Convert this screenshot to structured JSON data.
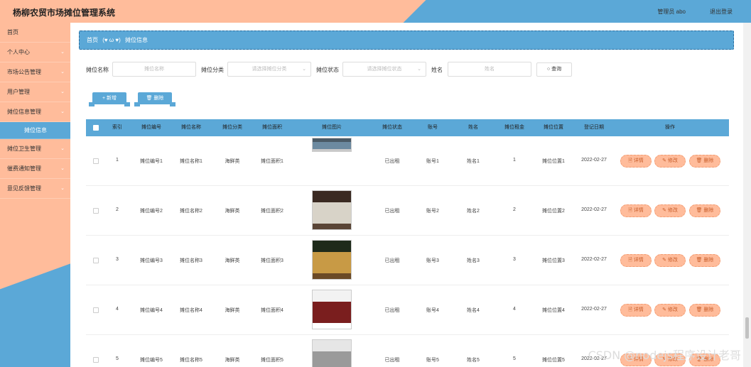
{
  "header": {
    "title": "杨柳农贸市场摊位管理系统",
    "user": "管理员 abo",
    "logout": "退出登录"
  },
  "sidebar": {
    "items": [
      {
        "label": "首页",
        "chev": ""
      },
      {
        "label": "个人中心",
        "chev": "⌄"
      },
      {
        "label": "市场公告管理",
        "chev": "⌄"
      },
      {
        "label": "用户管理",
        "chev": "⌄"
      },
      {
        "label": "摊位信息管理",
        "chev": "⌄"
      },
      {
        "label": "摊位信息",
        "chev": ""
      },
      {
        "label": "摊位卫生管理",
        "chev": "⌄"
      },
      {
        "label": "催费通知管理",
        "chev": "⌄"
      },
      {
        "label": "意见反馈管理",
        "chev": "⌄"
      }
    ]
  },
  "breadcrumb": {
    "home": "首页",
    "sep": "(♥ ω ♥)",
    "current": "摊位信息"
  },
  "filters": {
    "name_label": "摊位名称",
    "name_placeholder": "摊位名称",
    "category_label": "摊位分类",
    "category_placeholder": "请选择摊位分类",
    "status_label": "摊位状态",
    "status_placeholder": "请选择摊位状态",
    "person_label": "姓名",
    "person_placeholder": "姓名",
    "search_label": "查询"
  },
  "actions": {
    "add_label": "+ 新增",
    "delete_label": "🗑 删除"
  },
  "table": {
    "headers": [
      "索引",
      "摊位编号",
      "摊位名称",
      "摊位分类",
      "摊位面积",
      "摊位图片",
      "摊位状态",
      "账号",
      "姓名",
      "摊位租金",
      "摊位位置",
      "登记日期",
      "操作"
    ],
    "rows": [
      {
        "idx": "1",
        "code": "摊位编号1",
        "name": "摊位名称1",
        "cat": "海鲜类",
        "area": "摊位面积1",
        "status": "已出租",
        "account": "账号1",
        "person": "姓名1",
        "rent": "1",
        "loc": "摊位位置1",
        "date": "2022-02-27",
        "img": [
          "#4a5a66",
          "#6c8aa0",
          "#c9c9c9"
        ]
      },
      {
        "idx": "2",
        "code": "摊位编号2",
        "name": "摊位名称2",
        "cat": "海鲜类",
        "area": "摊位面积2",
        "status": "已出租",
        "account": "账号2",
        "person": "姓名2",
        "rent": "2",
        "loc": "摊位位置2",
        "date": "2022-02-27",
        "img": [
          "#3a2a22",
          "#d8d3c8",
          "#5a4536"
        ]
      },
      {
        "idx": "3",
        "code": "摊位编号3",
        "name": "摊位名称3",
        "cat": "海鲜类",
        "area": "摊位面积3",
        "status": "已出租",
        "account": "账号3",
        "person": "姓名3",
        "rent": "3",
        "loc": "摊位位置3",
        "date": "2022-02-27",
        "img": [
          "#1e2a1a",
          "#c89a45",
          "#6b4a26"
        ]
      },
      {
        "idx": "4",
        "code": "摊位编号4",
        "name": "摊位名称4",
        "cat": "海鲜类",
        "area": "摊位面积4",
        "status": "已出租",
        "account": "账号4",
        "person": "姓名4",
        "rent": "4",
        "loc": "摊位位置4",
        "date": "2022-02-27",
        "img": [
          "#f2f2f2",
          "#7a1e1e",
          "#ffffff"
        ]
      },
      {
        "idx": "5",
        "code": "摊位编号5",
        "name": "摊位名称5",
        "cat": "海鲜类",
        "area": "摊位面积5",
        "status": "已出租",
        "account": "账号5",
        "person": "姓名5",
        "rent": "5",
        "loc": "摊位位置5",
        "date": "2022-02-27",
        "img": [
          "#e6e6e6",
          "#9a9a9a",
          "#cfcfcf"
        ]
      }
    ],
    "ops": {
      "detail": "🗎 详情",
      "edit": "✎ 修改",
      "remove": "🗑 删除"
    }
  },
  "watermark": "CSDN @nodejs程序设计老哥",
  "colors": {
    "peach": "#ffbc9b",
    "blue": "#5ba8d7"
  }
}
